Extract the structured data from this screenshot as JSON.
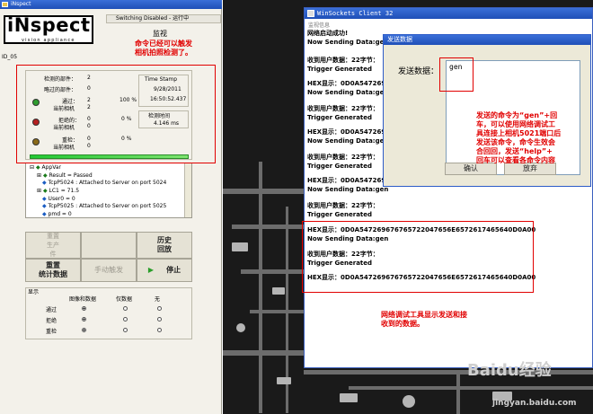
{
  "inspect": {
    "title": "iNspect",
    "logo": "iNspect",
    "logo_sub": "vision appliance",
    "status": "Switching Disabled - 运行中",
    "monitor": "监视",
    "id": "ID_05",
    "counts": [
      {
        "label": "检测的部件：",
        "value": "2"
      },
      {
        "label": "略过的部件：",
        "value": "0"
      }
    ],
    "stats": [
      {
        "led": "#2e9c2e",
        "label": "通过：",
        "value": "2",
        "pct": "100 %",
        "sub": "当前相机",
        "sub_value": "2"
      },
      {
        "led": "#b51f1f",
        "label": "拒绝的：",
        "value": "0",
        "pct": "0 %",
        "sub": "当前相机",
        "sub_value": "0"
      },
      {
        "led": "#8a6a18",
        "label": "重检：",
        "value": "0",
        "pct": "0 %",
        "sub": "当前相机",
        "sub_value": "0"
      }
    ],
    "timestamp": {
      "label": "Time Stamp",
      "date": "9/28/2011",
      "time": "16:50:52.437"
    },
    "detect_time": {
      "label": "检测时间",
      "value": "4.146 ms"
    },
    "progress": 1.0,
    "tree": [
      "AppVar",
      "Result = Passed",
      "TcpP5024 : Attached to Server on port 5024",
      "LC1 = 71.5",
      "User0 = 0",
      "TcpP5025 : Attached to Server on port 5025",
      "pmd = 0"
    ],
    "buttons": {
      "reset_prod": "重置\n生产\n件",
      "history": "历史\n回放",
      "reset_stats": "重置\n统计数据",
      "manual_trigger": "手动触发",
      "stop": "停止"
    },
    "display": {
      "title": "显示",
      "col_image_data": "图像和数据",
      "col_data_only": "仅数据",
      "col_none": "无",
      "rows": [
        "通过",
        "拒绝",
        "重检"
      ]
    }
  },
  "annotations": {
    "top": "命令已经可以触发\n相机拍照检测了。",
    "dialog": "发送的命令为“gen”+回\n车，可以使用网络调试工\n具连接上相机5021端口后\n发送该命令，命令生效会\n合回回，发送“help”+\n回车可以查看各命令内容",
    "bottom": "网络调试工具显示发送和接\n收到的数据。"
  },
  "winsockets": {
    "title": "WinSockets Client 32",
    "header": "监视信息",
    "lines": [
      "网络启动成功!",
      "Now Sending Data:gen",
      "收到用户数据：22字节：",
      "Trigger Generated",
      "HEX显示：0D0A5472694",
      "Now Sending Data:gen",
      "收到用户数据：22字节：",
      "Trigger Generated",
      "HEX显示：0D0A5472694",
      "Now Sending Data:gen",
      "收到用户数据：22字节：",
      "Trigger Generated",
      "HEX显示：0D0A5472694",
      "Now Sending Data:gen",
      "收到用户数据：22字节：",
      "Trigger Generated",
      "HEX显示：0D0A547269676765722047656E6572617465640D0A00",
      "Now Sending Data:gen",
      "收到用户数据：22字节：",
      "Trigger Generated",
      "HEX显示：0D0A547269676765722047656E6572617465640D0A00"
    ]
  },
  "dialog": {
    "title": "发送数据",
    "label": "发送数据：",
    "value": "gen",
    "ok": "确认",
    "cancel": "放弃"
  },
  "watermark": {
    "brand": "Baidu经验",
    "url": "jingyan.baidu.com"
  }
}
